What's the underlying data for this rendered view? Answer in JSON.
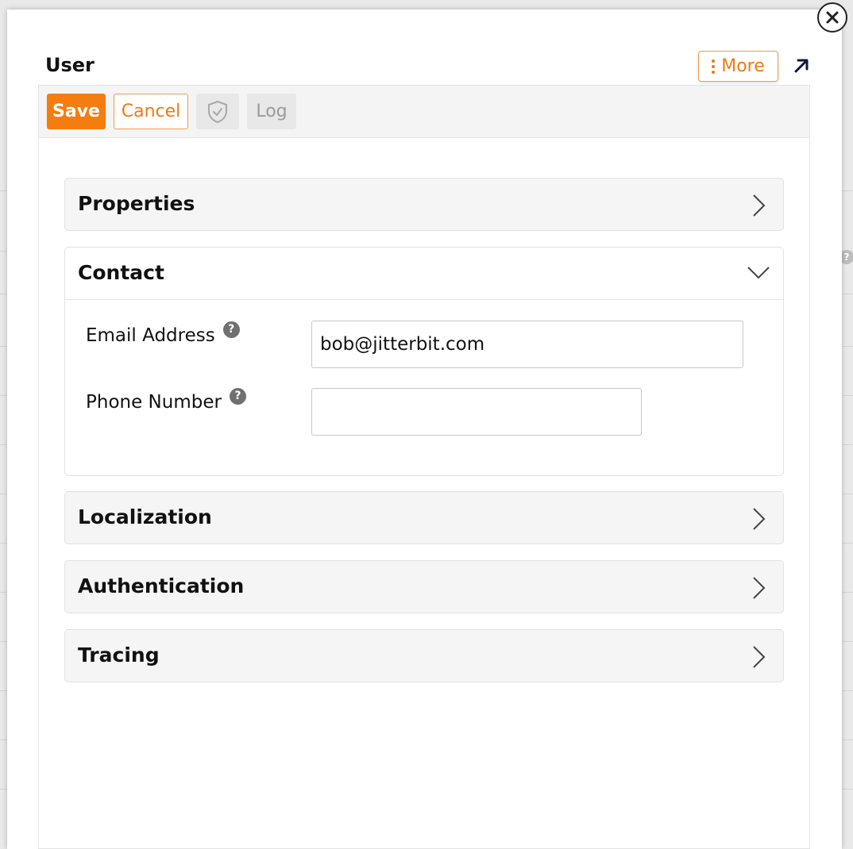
{
  "dialog": {
    "title": "User",
    "more_label": "More"
  },
  "toolbar": {
    "save_label": "Save",
    "cancel_label": "Cancel",
    "log_label": "Log"
  },
  "sections": {
    "properties": "Properties",
    "contact": "Contact",
    "localization": "Localization",
    "authentication": "Authentication",
    "tracing": "Tracing"
  },
  "contact": {
    "email_label": "Email Address",
    "email_value": "bob@jitterbit.com",
    "phone_label": "Phone Number",
    "phone_value": ""
  },
  "icons": {
    "close": "close-icon",
    "more": "kebab-icon",
    "expand": "arrow-up-right-icon",
    "shield": "shield-check-icon",
    "chevron_right": "chevron-right-icon",
    "chevron_down": "chevron-down-icon",
    "help": "question-circle-icon"
  },
  "colors": {
    "accent": "#f57c0f",
    "accent_text": "#f07a12"
  }
}
